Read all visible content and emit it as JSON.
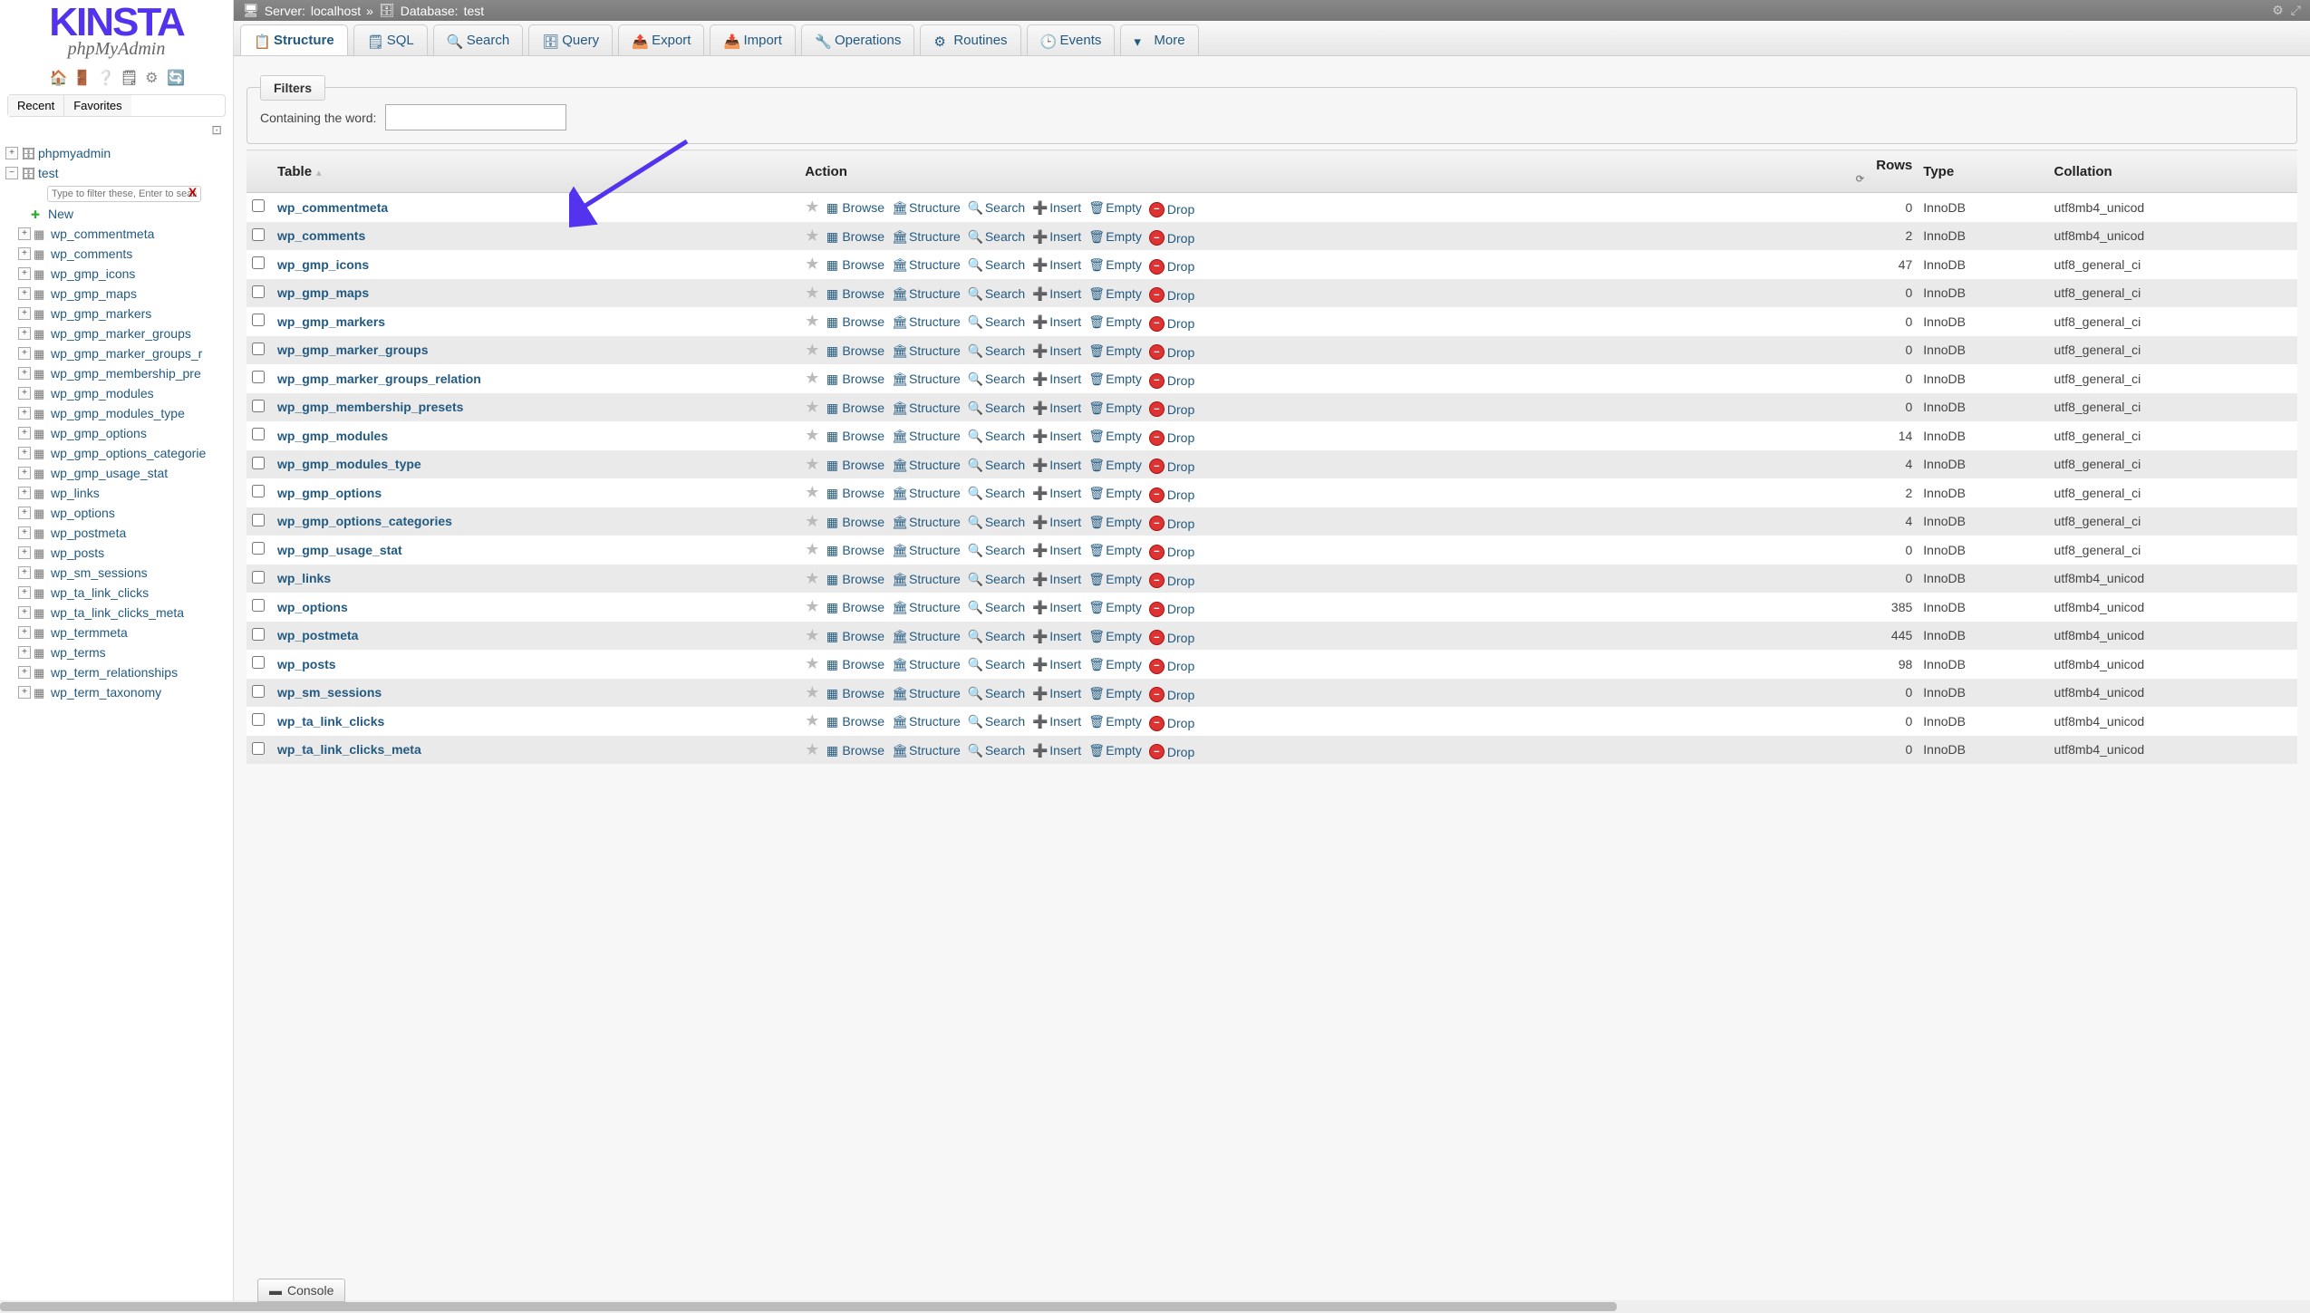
{
  "logo": {
    "main": "KINSTA",
    "sub": "phpMyAdmin"
  },
  "recentFav": {
    "recent": "Recent",
    "favorites": "Favorites"
  },
  "tree": {
    "root": "phpmyadmin",
    "db": "test",
    "filterPlaceholder": "Type to filter these, Enter to search",
    "newLabel": "New",
    "tables": [
      "wp_commentmeta",
      "wp_comments",
      "wp_gmp_icons",
      "wp_gmp_maps",
      "wp_gmp_markers",
      "wp_gmp_marker_groups",
      "wp_gmp_marker_groups_r",
      "wp_gmp_membership_pre",
      "wp_gmp_modules",
      "wp_gmp_modules_type",
      "wp_gmp_options",
      "wp_gmp_options_categorie",
      "wp_gmp_usage_stat",
      "wp_links",
      "wp_options",
      "wp_postmeta",
      "wp_posts",
      "wp_sm_sessions",
      "wp_ta_link_clicks",
      "wp_ta_link_clicks_meta",
      "wp_termmeta",
      "wp_terms",
      "wp_term_relationships",
      "wp_term_taxonomy"
    ]
  },
  "topbar": {
    "serverLabel": "Server:",
    "server": "localhost",
    "sep": "»",
    "dbLabel": "Database:",
    "db": "test"
  },
  "tabs": [
    {
      "label": "Structure",
      "icon": "📋",
      "active": true
    },
    {
      "label": "SQL",
      "icon": "🗒"
    },
    {
      "label": "Search",
      "icon": "🔍"
    },
    {
      "label": "Query",
      "icon": "🗄"
    },
    {
      "label": "Export",
      "icon": "📤"
    },
    {
      "label": "Import",
      "icon": "📥"
    },
    {
      "label": "Operations",
      "icon": "🔧"
    },
    {
      "label": "Routines",
      "icon": "⚙"
    },
    {
      "label": "Events",
      "icon": "🕒"
    },
    {
      "label": "More",
      "icon": "▾"
    }
  ],
  "filters": {
    "legend": "Filters",
    "label": "Containing the word:",
    "value": ""
  },
  "columns": {
    "table": "Table",
    "action": "Action",
    "rows": "Rows",
    "type": "Type",
    "collation": "Collation"
  },
  "actions": {
    "browse": "Browse",
    "structure": "Structure",
    "search": "Search",
    "insert": "Insert",
    "empty": "Empty",
    "drop": "Drop"
  },
  "rows": [
    {
      "name": "wp_commentmeta",
      "rows": "0",
      "type": "InnoDB",
      "coll": "utf8mb4_unicod"
    },
    {
      "name": "wp_comments",
      "rows": "2",
      "type": "InnoDB",
      "coll": "utf8mb4_unicod"
    },
    {
      "name": "wp_gmp_icons",
      "rows": "47",
      "type": "InnoDB",
      "coll": "utf8_general_ci"
    },
    {
      "name": "wp_gmp_maps",
      "rows": "0",
      "type": "InnoDB",
      "coll": "utf8_general_ci"
    },
    {
      "name": "wp_gmp_markers",
      "rows": "0",
      "type": "InnoDB",
      "coll": "utf8_general_ci"
    },
    {
      "name": "wp_gmp_marker_groups",
      "rows": "0",
      "type": "InnoDB",
      "coll": "utf8_general_ci"
    },
    {
      "name": "wp_gmp_marker_groups_relation",
      "rows": "0",
      "type": "InnoDB",
      "coll": "utf8_general_ci"
    },
    {
      "name": "wp_gmp_membership_presets",
      "rows": "0",
      "type": "InnoDB",
      "coll": "utf8_general_ci"
    },
    {
      "name": "wp_gmp_modules",
      "rows": "14",
      "type": "InnoDB",
      "coll": "utf8_general_ci"
    },
    {
      "name": "wp_gmp_modules_type",
      "rows": "4",
      "type": "InnoDB",
      "coll": "utf8_general_ci"
    },
    {
      "name": "wp_gmp_options",
      "rows": "2",
      "type": "InnoDB",
      "coll": "utf8_general_ci"
    },
    {
      "name": "wp_gmp_options_categories",
      "rows": "4",
      "type": "InnoDB",
      "coll": "utf8_general_ci"
    },
    {
      "name": "wp_gmp_usage_stat",
      "rows": "0",
      "type": "InnoDB",
      "coll": "utf8_general_ci"
    },
    {
      "name": "wp_links",
      "rows": "0",
      "type": "InnoDB",
      "coll": "utf8mb4_unicod"
    },
    {
      "name": "wp_options",
      "rows": "385",
      "type": "InnoDB",
      "coll": "utf8mb4_unicod"
    },
    {
      "name": "wp_postmeta",
      "rows": "445",
      "type": "InnoDB",
      "coll": "utf8mb4_unicod"
    },
    {
      "name": "wp_posts",
      "rows": "98",
      "type": "InnoDB",
      "coll": "utf8mb4_unicod"
    },
    {
      "name": "wp_sm_sessions",
      "rows": "0",
      "type": "InnoDB",
      "coll": "utf8mb4_unicod"
    },
    {
      "name": "wp_ta_link_clicks",
      "rows": "0",
      "type": "InnoDB",
      "coll": "utf8mb4_unicod"
    },
    {
      "name": "wp_ta_link_clicks_meta",
      "rows": "0",
      "type": "InnoDB",
      "coll": "utf8mb4_unicod"
    }
  ],
  "console": "Console"
}
